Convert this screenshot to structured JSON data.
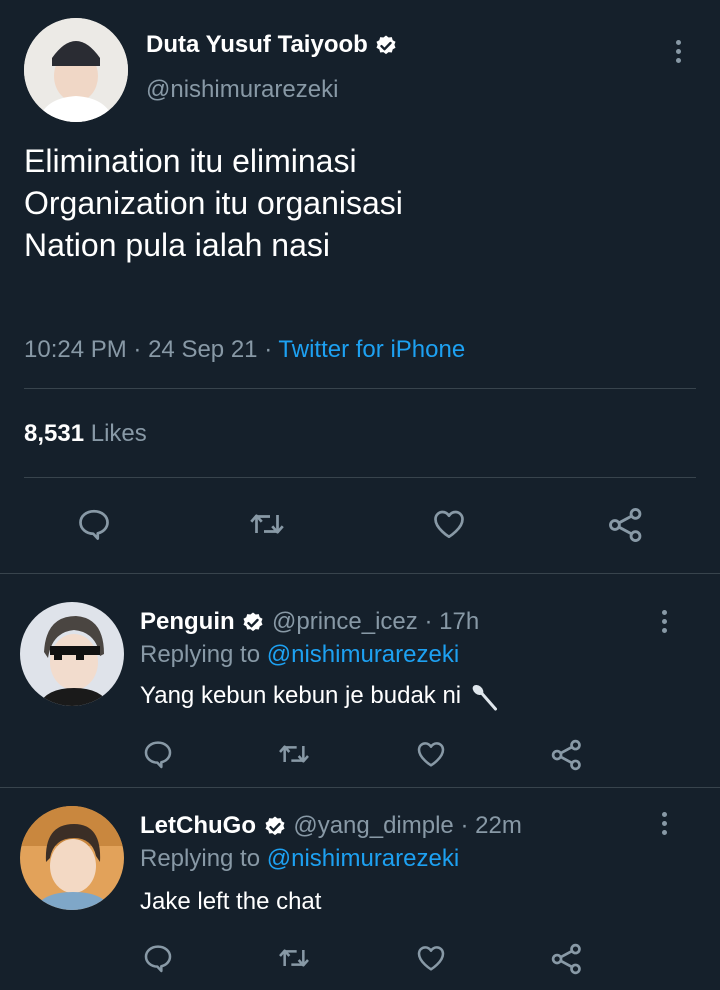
{
  "tweet": {
    "author_name": "Duta Yusuf Taiyoob",
    "author_handle": "@nishimurarezeki",
    "lines": [
      "Elimination itu eliminasi",
      "Organization itu organisasi",
      "Nation pula ialah nasi"
    ],
    "time": "10:24 PM",
    "date": "24 Sep 21",
    "source": "Twitter for iPhone",
    "separator": "·",
    "likes_count": "8,531",
    "likes_label": "Likes"
  },
  "replies": [
    {
      "name": "Penguin",
      "handle": "@prince_icez",
      "age": "17h",
      "replying_label": "Replying to",
      "replying_to": "@nishimurarezeki",
      "text": "Yang kebun kebun je budak ni",
      "emoji": "spoon-icon"
    },
    {
      "name": "LetChuGo",
      "handle": "@yang_dimple",
      "age": "22m",
      "replying_label": "Replying to",
      "replying_to": "@nishimurarezeki",
      "text": "Jake left the chat"
    }
  ],
  "icons": [
    "verified-badge-icon",
    "more-options-icon",
    "reply-icon",
    "retweet-icon",
    "like-icon",
    "share-icon"
  ],
  "colors": {
    "background": "#15202b",
    "muted": "#8899a6",
    "accent": "#1da1f2",
    "divider": "#38444d"
  }
}
